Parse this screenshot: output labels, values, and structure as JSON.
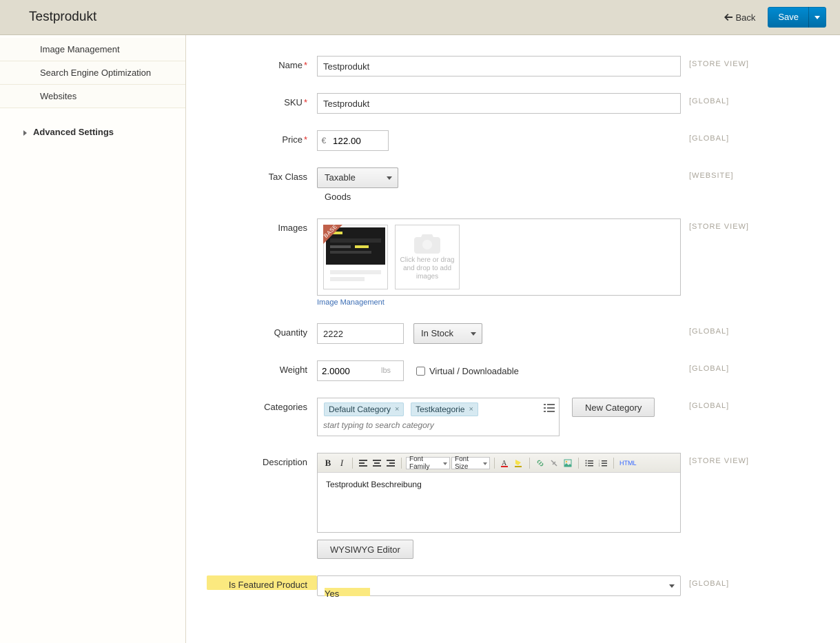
{
  "header": {
    "title": "Testprodukt",
    "back_label": "Back",
    "save_label": "Save"
  },
  "sidebar": {
    "items": [
      {
        "label": "Image Management"
      },
      {
        "label": "Search Engine Optimization"
      },
      {
        "label": "Websites"
      }
    ],
    "group": {
      "label": "Advanced Settings"
    }
  },
  "form": {
    "name": {
      "label": "Name",
      "value": "Testprodukt",
      "required": true,
      "scope": "[STORE VIEW]"
    },
    "sku": {
      "label": "SKU",
      "value": "Testprodukt",
      "required": true,
      "scope": "[GLOBAL]"
    },
    "price": {
      "label": "Price",
      "currency": "€",
      "value": "122.00",
      "required": true,
      "scope": "[GLOBAL]"
    },
    "taxclass": {
      "label": "Tax Class",
      "value": "Taxable Goods",
      "scope": "[WEBSITE]"
    },
    "images": {
      "label": "Images",
      "base_badge": "BASE",
      "placeholder_text": "Click here or drag and drop to add images",
      "link": "Image Management",
      "scope": "[STORE VIEW]"
    },
    "quantity": {
      "label": "Quantity",
      "value": "2222",
      "stock": "In Stock",
      "scope": "[GLOBAL]"
    },
    "weight": {
      "label": "Weight",
      "value": "2.0000",
      "unit": "lbs",
      "virtual_label": "Virtual / Downloadable",
      "virtual_checked": false,
      "scope": "[GLOBAL]"
    },
    "categories": {
      "label": "Categories",
      "tokens": [
        "Default Category",
        "Testkategorie"
      ],
      "placeholder": "start typing to search category",
      "new_btn": "New Category",
      "scope": "[GLOBAL]"
    },
    "description": {
      "label": "Description",
      "font_family_dd": "Font Family",
      "font_size_dd": "Font Size",
      "html_btn": "HTML",
      "content": "Testprodukt Beschreibung",
      "wysiwyg_btn": "WYSIWYG Editor",
      "scope": "[STORE VIEW]"
    },
    "featured": {
      "label": "Is Featured Product",
      "value": "Yes",
      "scope": "[GLOBAL]"
    }
  }
}
